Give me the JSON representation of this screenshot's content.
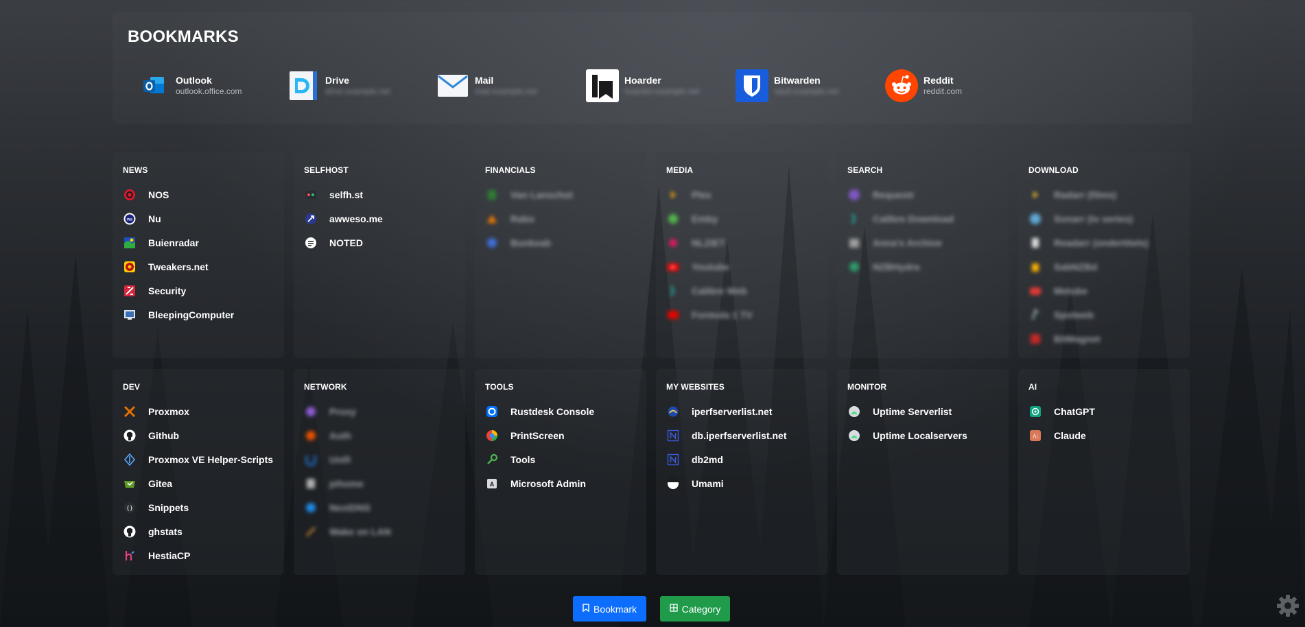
{
  "header": {
    "title": "BOOKMARKS"
  },
  "bookmarks": [
    {
      "name": "Outlook",
      "url": "outlook.office.com",
      "icon": "outlook-icon",
      "blurred": false
    },
    {
      "name": "Drive",
      "url": "drive.example.net",
      "icon": "drive-icon",
      "blurred": true
    },
    {
      "name": "Mail",
      "url": "mail.example.net",
      "icon": "mail-icon",
      "blurred": true
    },
    {
      "name": "Hoarder",
      "url": "hoarder.example.net",
      "icon": "hoarder-icon",
      "blurred": true
    },
    {
      "name": "Bitwarden",
      "url": "vault.example.net",
      "icon": "bitwarden-icon",
      "blurred": true
    },
    {
      "name": "Reddit",
      "url": "reddit.com",
      "icon": "reddit-icon",
      "blurred": false
    }
  ],
  "categories": [
    {
      "title": "NEWS",
      "items": [
        {
          "label": "NOS",
          "icon": "nos-icon"
        },
        {
          "label": "Nu",
          "icon": "nu-icon"
        },
        {
          "label": "Buienradar",
          "icon": "buienradar-icon"
        },
        {
          "label": "Tweakers.net",
          "icon": "tweakers-icon"
        },
        {
          "label": "Security",
          "icon": "security-icon"
        },
        {
          "label": "BleepingComputer",
          "icon": "bleepingcomputer-icon"
        }
      ]
    },
    {
      "title": "SELFHOST",
      "items": [
        {
          "label": "selfh.st",
          "icon": "selfhst-icon"
        },
        {
          "label": "awweso.me",
          "icon": "awwesome-icon"
        },
        {
          "label": "NOTED",
          "icon": "noted-icon"
        }
      ]
    },
    {
      "title": "FINANCIALS",
      "items": [
        {
          "label": "Van Lanschot",
          "icon": "bank-icon",
          "blur": true
        },
        {
          "label": "Rabo",
          "icon": "rabo-icon",
          "blur": true
        },
        {
          "label": "Bunkeab",
          "icon": "budget-icon",
          "blur": true
        }
      ]
    },
    {
      "title": "MEDIA",
      "items": [
        {
          "label": "Plex",
          "icon": "plex-icon",
          "blur": true
        },
        {
          "label": "Emby",
          "icon": "emby-icon",
          "blur": true
        },
        {
          "label": "NLZIET",
          "icon": "nlziet-icon",
          "blur": true
        },
        {
          "label": "Youtube",
          "icon": "youtube-icon",
          "blur": true
        },
        {
          "label": "Calibre Web",
          "icon": "calibre-icon",
          "blur": true
        },
        {
          "label": "Formula 1 TV",
          "icon": "f1-icon",
          "blur": true
        }
      ]
    },
    {
      "title": "SEARCH",
      "items": [
        {
          "label": "Requestr",
          "icon": "request-icon",
          "blur": true
        },
        {
          "label": "Calibre Download",
          "icon": "calibre-download-icon",
          "blur": true
        },
        {
          "label": "Anna's Archive",
          "icon": "archive-icon",
          "blur": true
        },
        {
          "label": "NZBHydra",
          "icon": "nzbhydra-icon",
          "blur": true
        }
      ]
    },
    {
      "title": "DOWNLOAD",
      "items": [
        {
          "label": "Radarr (films)",
          "icon": "radarr-icon",
          "blur": true
        },
        {
          "label": "Sonarr (tv series)",
          "icon": "sonarr-icon",
          "blur": true
        },
        {
          "label": "Readarr (ondertitels)",
          "icon": "readarr-icon",
          "blur": true
        },
        {
          "label": "SabNZBd",
          "icon": "sabnzbd-icon",
          "blur": true
        },
        {
          "label": "Metube",
          "icon": "metube-icon",
          "blur": true
        },
        {
          "label": "Spotweb",
          "icon": "spotweb-icon",
          "blur": true
        },
        {
          "label": "BitMagnet",
          "icon": "bitmagnet-icon",
          "blur": true
        }
      ]
    },
    {
      "title": "DEV",
      "items": [
        {
          "label": "Proxmox",
          "icon": "proxmox-icon"
        },
        {
          "label": "Github",
          "icon": "github-icon"
        },
        {
          "label": "Proxmox VE Helper-Scripts",
          "icon": "helper-scripts-icon"
        },
        {
          "label": "Gitea",
          "icon": "gitea-icon"
        },
        {
          "label": "Snippets",
          "icon": "snippets-icon"
        },
        {
          "label": "ghstats",
          "icon": "github-icon"
        },
        {
          "label": "HestiaCP",
          "icon": "hestiacp-icon"
        }
      ]
    },
    {
      "title": "NETWORK",
      "items": [
        {
          "label": "Proxy",
          "icon": "proxy-icon",
          "blur": true
        },
        {
          "label": "Auth",
          "icon": "auth-icon",
          "blur": true
        },
        {
          "label": "Unifi",
          "icon": "unifi-icon",
          "blur": true
        },
        {
          "label": "pihome",
          "icon": "pihole-icon",
          "blur": true
        },
        {
          "label": "NextDNS",
          "icon": "nextdns-icon",
          "blur": true
        },
        {
          "label": "Wake on LAN",
          "icon": "wol-icon",
          "blur": true
        }
      ]
    },
    {
      "title": "TOOLS",
      "items": [
        {
          "label": "Rustdesk Console",
          "icon": "rustdesk-icon"
        },
        {
          "label": "PrintScreen",
          "icon": "printscreen-icon"
        },
        {
          "label": "Tools",
          "icon": "tools-icon"
        },
        {
          "label": "Microsoft Admin",
          "icon": "microsoft-admin-icon"
        }
      ]
    },
    {
      "title": "MY WEBSITES",
      "items": [
        {
          "label": "iperfserverlist.net",
          "icon": "iperf-icon"
        },
        {
          "label": "db.iperfserverlist.net",
          "icon": "notion-icon"
        },
        {
          "label": "db2md",
          "icon": "notion-icon"
        },
        {
          "label": "Umami",
          "icon": "umami-icon"
        }
      ]
    },
    {
      "title": "MONITOR",
      "items": [
        {
          "label": "Uptime Serverlist",
          "icon": "uptime-kuma-icon"
        },
        {
          "label": "Uptime Localservers",
          "icon": "uptime-kuma-icon"
        }
      ]
    },
    {
      "title": "AI",
      "items": [
        {
          "label": "ChatGPT",
          "icon": "chatgpt-icon"
        },
        {
          "label": "Claude",
          "icon": "claude-icon"
        }
      ]
    }
  ],
  "footer": {
    "bookmark_label": "Bookmark",
    "category_label": "Category"
  },
  "colors": {
    "bookmark_button": "#0d6efd",
    "category_button": "#1f9b4a"
  }
}
